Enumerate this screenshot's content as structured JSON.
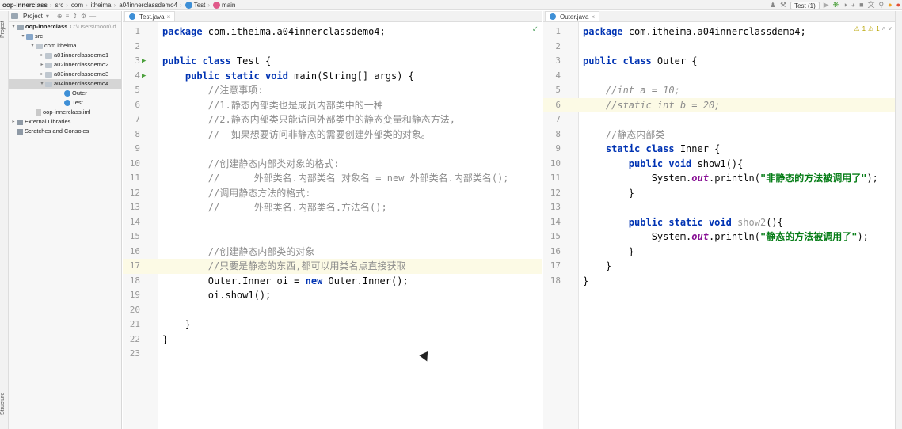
{
  "breadcrumb": [
    "oop-innerclass",
    "src",
    "com",
    "itheima",
    "a04innerclassdemo4",
    "Test",
    "main"
  ],
  "toolbar": {
    "run_config": "Test (1)"
  },
  "side_tabs": {
    "project": "Project",
    "structure": "Structure"
  },
  "project_panel": {
    "title": "Project",
    "tree": [
      {
        "label": "oop-innerclass",
        "extra": "C:\\Users\\moon\\Id",
        "level": 0,
        "icon": "module-folder-icon",
        "expanded": true
      },
      {
        "label": "src",
        "level": 1,
        "icon": "source-folder-icon",
        "expanded": true
      },
      {
        "label": "com.itheima",
        "level": 2,
        "icon": "package-icon",
        "expanded": true
      },
      {
        "label": "a01innerclassdemo1",
        "level": 3,
        "icon": "package-icon",
        "expanded": false
      },
      {
        "label": "a02innerclassdemo2",
        "level": 3,
        "icon": "package-icon",
        "expanded": false
      },
      {
        "label": "a03innerclassdemo3",
        "level": 3,
        "icon": "package-icon",
        "expanded": false
      },
      {
        "label": "a04innerclassdemo4",
        "level": 3,
        "icon": "package-icon",
        "expanded": true,
        "selected": true
      },
      {
        "label": "Outer",
        "level": 5,
        "icon": "class-icon"
      },
      {
        "label": "Test",
        "level": 5,
        "icon": "class-icon"
      },
      {
        "label": "oop-innerclass.iml",
        "level": 2,
        "icon": "iml-file-icon"
      },
      {
        "label": "External Libraries",
        "level": 0,
        "icon": "library-icon",
        "expanded": false
      },
      {
        "label": "Scratches and Consoles",
        "level": 0,
        "icon": "scratch-icon"
      }
    ]
  },
  "editor_left": {
    "tab": "Test.java",
    "highlight_line": 17,
    "lines": [
      [
        [
          "k",
          "package "
        ],
        [
          "p",
          "com.itheima.a04innerclassdemo4;"
        ]
      ],
      [],
      [
        [
          "k",
          "public class "
        ],
        [
          "p",
          "Test {"
        ]
      ],
      [
        [
          "p",
          "    "
        ],
        [
          "k",
          "public static void "
        ],
        [
          "p",
          "main(String[] args) {"
        ]
      ],
      [
        [
          "p",
          "        "
        ],
        [
          "cz",
          "//注意事项:"
        ]
      ],
      [
        [
          "p",
          "        "
        ],
        [
          "cz",
          "//1.静态内部类也是成员内部类中的一种"
        ]
      ],
      [
        [
          "p",
          "        "
        ],
        [
          "cz",
          "//2.静态内部类只能访问外部类中的静态变量和静态方法,"
        ]
      ],
      [
        [
          "p",
          "        "
        ],
        [
          "cz",
          "//  如果想要访问非静态的需要创建外部类的对象。"
        ]
      ],
      [],
      [
        [
          "p",
          "        "
        ],
        [
          "cz",
          "//创建静态内部类对象的格式:"
        ]
      ],
      [
        [
          "p",
          "        "
        ],
        [
          "cz",
          "//      外部类名.内部类名 对象名 = new 外部类名.内部类名();"
        ]
      ],
      [
        [
          "p",
          "        "
        ],
        [
          "cz",
          "//调用静态方法的格式:"
        ]
      ],
      [
        [
          "p",
          "        "
        ],
        [
          "cz",
          "//      外部类名.内部类名.方法名();"
        ]
      ],
      [],
      [],
      [
        [
          "p",
          "        "
        ],
        [
          "cz",
          "//创建静态内部类的对象"
        ]
      ],
      [
        [
          "p",
          "        "
        ],
        [
          "cz",
          "//只要是静态的东西,都可以用类名点直接获取"
        ]
      ],
      [
        [
          "p",
          "        Outer.Inner oi = "
        ],
        [
          "k",
          "new "
        ],
        [
          "p",
          "Outer.Inner();"
        ]
      ],
      [
        [
          "p",
          "        oi.show1();"
        ]
      ],
      [],
      [
        [
          "p",
          "    }"
        ]
      ],
      [
        [
          "p",
          "}"
        ]
      ],
      []
    ],
    "run_markers": [
      3,
      4
    ]
  },
  "editor_right": {
    "tab": "Outer.java",
    "warnings": "1",
    "highlight_line": 6,
    "lines": [
      [
        [
          "k",
          "package "
        ],
        [
          "p",
          "com.itheima.a04innerclassdemo4;"
        ]
      ],
      [],
      [
        [
          "k",
          "public class "
        ],
        [
          "p",
          "Outer {"
        ]
      ],
      [],
      [
        [
          "p",
          "    "
        ],
        [
          "c",
          "//int a = 10;"
        ]
      ],
      [
        [
          "p",
          "    "
        ],
        [
          "c",
          "//static int b = 20;"
        ]
      ],
      [],
      [
        [
          "p",
          "    "
        ],
        [
          "cz",
          "//静态内部类"
        ]
      ],
      [
        [
          "p",
          "    "
        ],
        [
          "k",
          "static class "
        ],
        [
          "p",
          "Inner {"
        ]
      ],
      [
        [
          "p",
          "        "
        ],
        [
          "k",
          "public void "
        ],
        [
          "p",
          "show1(){"
        ]
      ],
      [
        [
          "p",
          "            System."
        ],
        [
          "f",
          "out"
        ],
        [
          "p",
          ".println("
        ],
        [
          "s",
          "\"非静态的方法被调用了\""
        ],
        [
          "p",
          ");"
        ]
      ],
      [
        [
          "p",
          "        }"
        ]
      ],
      [],
      [
        [
          "p",
          "        "
        ],
        [
          "k",
          "public static void "
        ],
        [
          "un",
          "show2"
        ],
        [
          "p",
          "(){"
        ]
      ],
      [
        [
          "p",
          "            System."
        ],
        [
          "f",
          "out"
        ],
        [
          "p",
          ".println("
        ],
        [
          "s",
          "\"静态的方法被调用了\""
        ],
        [
          "p",
          ");"
        ]
      ],
      [
        [
          "p",
          "        }"
        ]
      ],
      [
        [
          "p",
          "    }"
        ]
      ],
      [
        [
          "p",
          "}"
        ]
      ]
    ]
  }
}
